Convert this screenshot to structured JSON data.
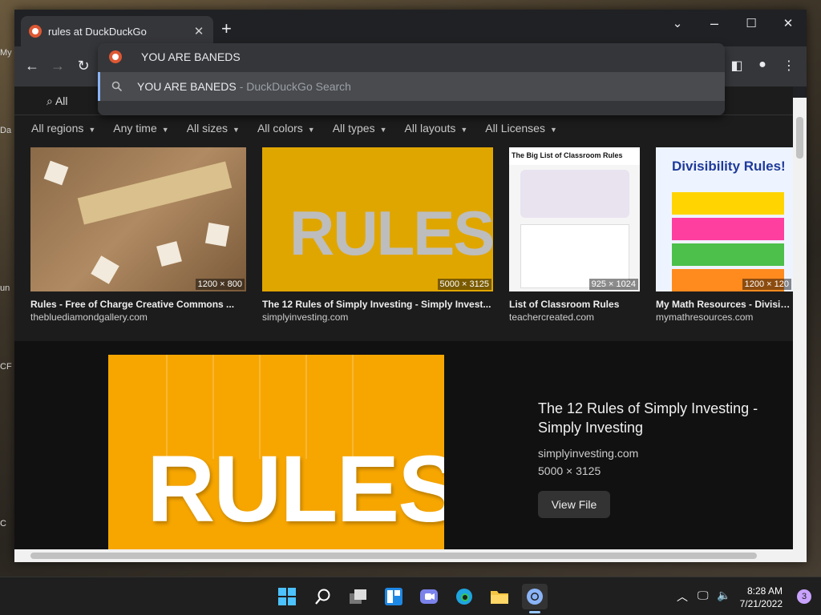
{
  "desktop": {
    "labels": [
      "My",
      "Da",
      "un",
      "CF",
      "C"
    ]
  },
  "browser": {
    "tab": {
      "title": "rules at DuckDuckGo"
    },
    "omnibox": {
      "value": "YOU ARE BANEDS",
      "suggestion": "YOU ARE BANEDS",
      "suggestion_suffix": "- DuckDuckGo Search"
    }
  },
  "page": {
    "tab_all": "All",
    "filters": [
      "All regions",
      "Any time",
      "All sizes",
      "All colors",
      "All types",
      "All layouts",
      "All Licenses"
    ],
    "results": [
      {
        "title": "Rules - Free of Charge Creative Commons ...",
        "domain": "thebluediamondgallery.com",
        "dims": "1200 × 800"
      },
      {
        "title": "The 12 Rules of Simply Investing - Simply Invest...",
        "domain": "simplyinvesting.com",
        "dims": "5000 × 3125"
      },
      {
        "title": "List of Classroom Rules",
        "domain": "teachercreated.com",
        "dims": "925 × 1024"
      },
      {
        "title": "My Math Resources - Divisibi...",
        "domain": "mymathresources.com",
        "dims": "1200 × 120"
      }
    ],
    "thumb_text": {
      "rules_big": "RULES",
      "classroom_header": "The Big List of Classroom Rules",
      "divisibility_header": "Divisibility Rules!"
    },
    "detail": {
      "title": "The 12 Rules of Simply Investing - Simply Investing",
      "domain": "simplyinvesting.com",
      "dims": "5000 × 3125",
      "button": "View File",
      "image_text": "RULES"
    }
  },
  "taskbar": {
    "time": "8:28 AM",
    "date": "7/21/2022",
    "notifications": "3"
  }
}
